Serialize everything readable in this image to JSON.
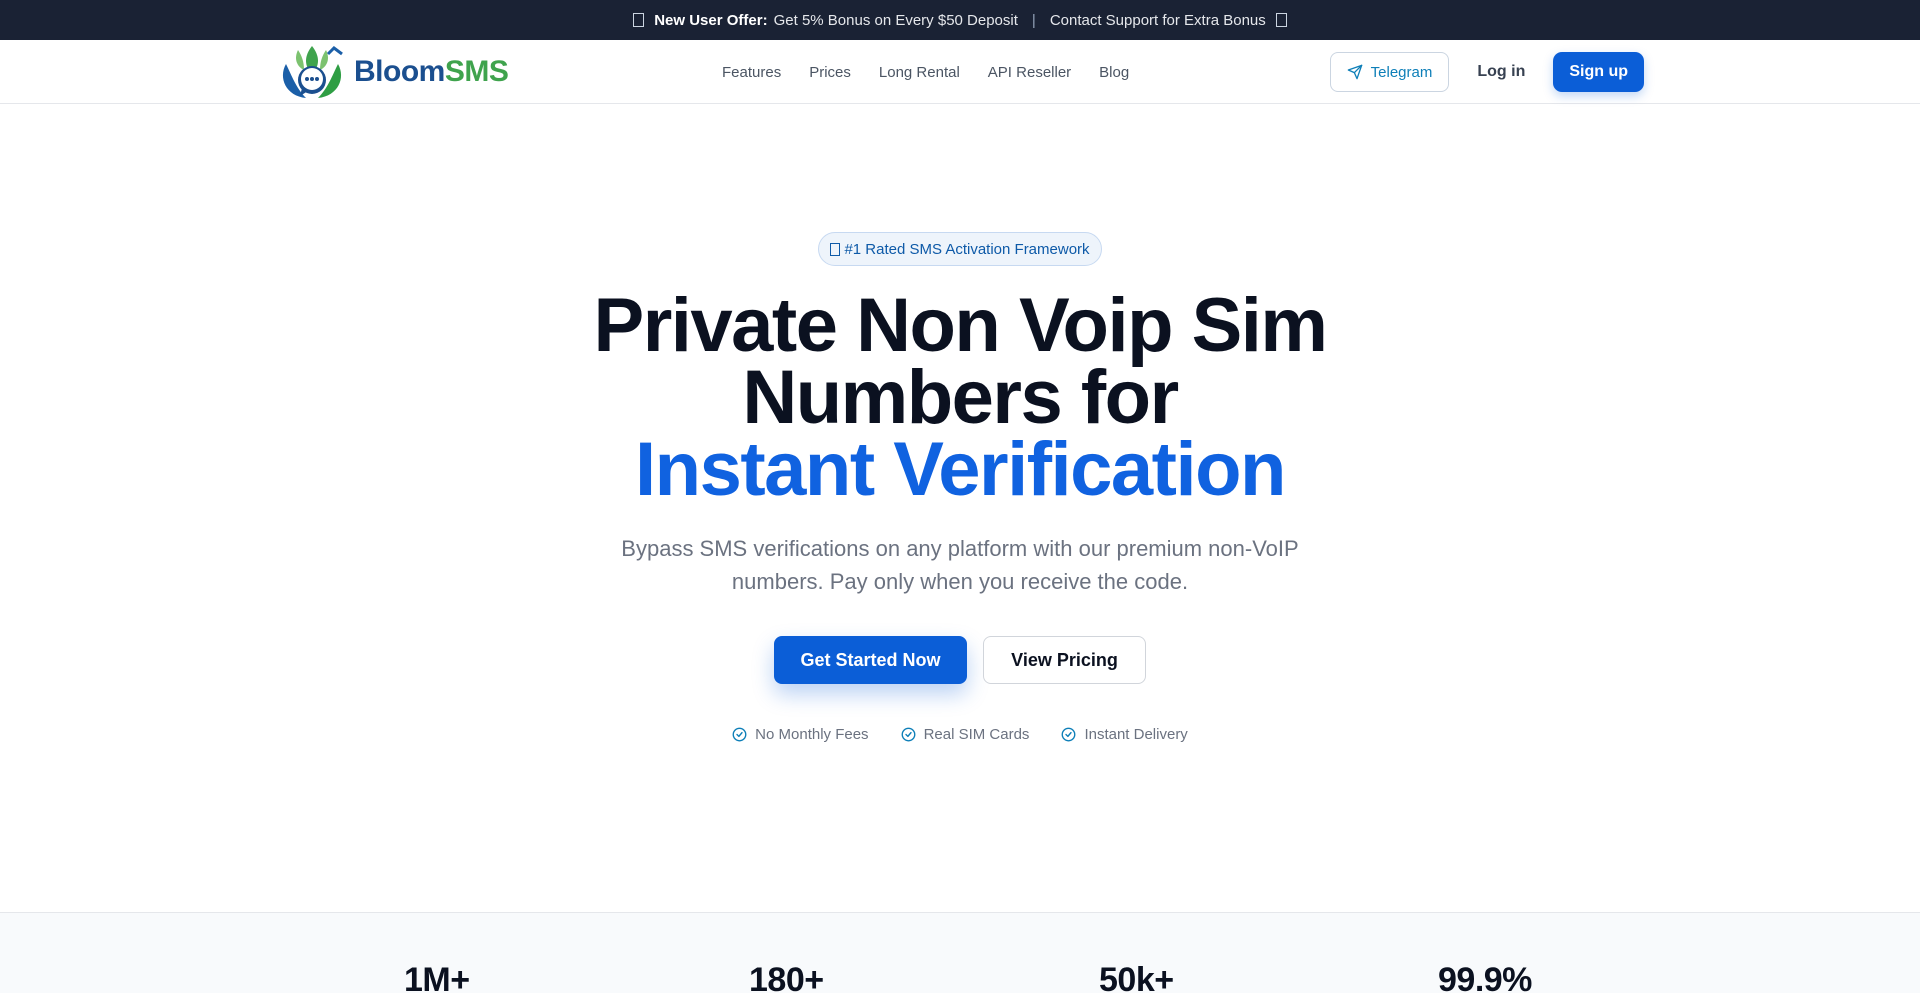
{
  "promo": {
    "offer_label": "New User Offer:",
    "offer_text": "Get 5% Bonus on Every $50 Deposit",
    "separator": "|",
    "support_text": "Contact Support for Extra Bonus"
  },
  "brand": {
    "name_part1": "Bloom",
    "name_part2": "SMS",
    "colors": {
      "primary": "#0b5ed7",
      "accent_text": "#1062e0",
      "logo_blue": "#1b4f8f",
      "logo_green": "#3fa34d"
    }
  },
  "nav": {
    "menu": [
      "Features",
      "Prices",
      "Long Rental",
      "API Reseller",
      "Blog"
    ],
    "telegram_label": "Telegram",
    "login_label": "Log in",
    "signup_label": "Sign up"
  },
  "hero": {
    "badge": "#1 Rated SMS Activation Framework",
    "headline_line1": "Private Non Voip Sim",
    "headline_line2": "Numbers for",
    "headline_accent": "Instant Verification",
    "subtitle_line1": "Bypass SMS verifications on any platform with our premium non-VoIP",
    "subtitle_line2": "numbers. Pay only when you receive the code.",
    "primary_cta": "Get Started Now",
    "secondary_cta": "View Pricing",
    "perks": [
      "No Monthly Fees",
      "Real SIM Cards",
      "Instant Delivery"
    ]
  },
  "stats": [
    "1M+",
    "180+",
    "50k+",
    "99.9%"
  ],
  "icons": {
    "telegram": "paper-plane-icon",
    "perk": "check-circle-icon",
    "emoji_placeholder": "missing-glyph-icon"
  }
}
